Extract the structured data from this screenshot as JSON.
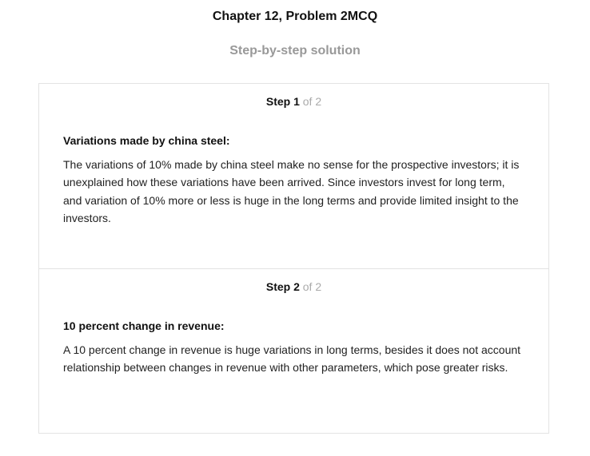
{
  "page": {
    "title": "Chapter 12, Problem 2MCQ",
    "subtitle": "Step-by-step solution"
  },
  "steps": [
    {
      "label": "Step 1",
      "of": "of 2",
      "heading": "Variations made by china steel:",
      "text": "The variations of 10% made by china steel make no sense for the prospective investors; it is unexplained how these variations have been arrived. Since investors invest for long term, and variation of 10% more or less is huge in the long terms and provide limited insight to the investors."
    },
    {
      "label": "Step 2",
      "of": "of 2",
      "heading": "10 percent change in revenue:",
      "text": "A 10 percent change in revenue is huge variations in long terms, besides it does not account relationship between changes in revenue with other parameters, which pose greater risks."
    }
  ]
}
